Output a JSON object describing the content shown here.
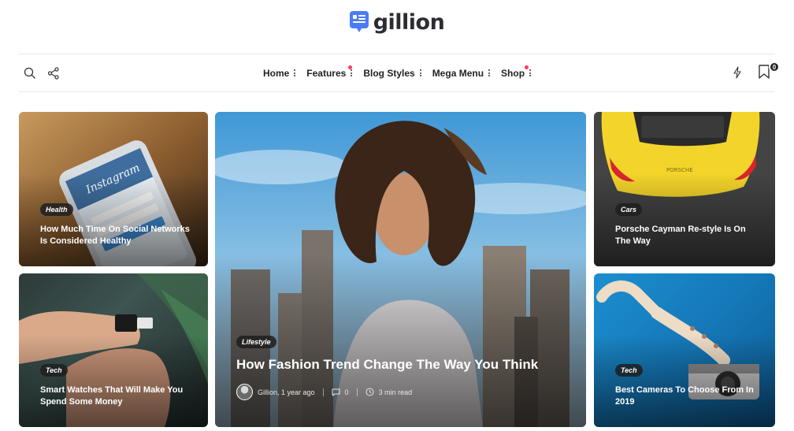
{
  "brand": {
    "name": "gillion",
    "accent": "#4b7bf5"
  },
  "header": {
    "left_icons": [
      "search-icon",
      "share-icon"
    ],
    "right_icons": [
      "flash-icon",
      "bookmark-icon"
    ],
    "bookmark_count": "0"
  },
  "nav": {
    "items": [
      {
        "label": "Home",
        "dot": false
      },
      {
        "label": "Features",
        "dot": true
      },
      {
        "label": "Blog Styles",
        "dot": false
      },
      {
        "label": "Mega Menu",
        "dot": false
      },
      {
        "label": "Shop",
        "dot": true
      }
    ],
    "dot_color": "#ff3b5c"
  },
  "posts": {
    "health": {
      "category": "Health",
      "title": "How Much Time On Social Networks Is Considered Healthy"
    },
    "watch": {
      "category": "Tech",
      "title": "Smart Watches That Will Make You Spend Some Money"
    },
    "featured": {
      "category": "Lifestyle",
      "title": "How Fashion Trend Change The Way You Think",
      "author": "Gillion, 1 year ago",
      "comments": "0",
      "read_time": "3 min read"
    },
    "cars": {
      "category": "Cars",
      "title": "Porsche Cayman Re-style Is On The Way"
    },
    "camera": {
      "category": "Tech",
      "title": "Best Cameras To Choose From In 2019"
    }
  }
}
